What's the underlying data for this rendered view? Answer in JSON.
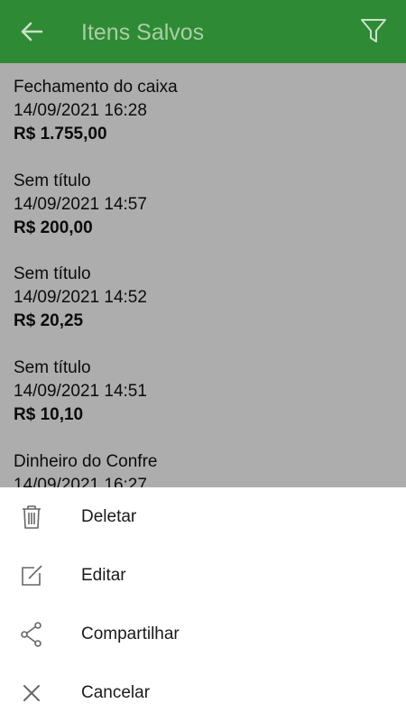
{
  "header": {
    "title": "Itens Salvos",
    "background": "#2f8a35",
    "back_icon": "arrow-left-icon",
    "filter_icon": "filter-icon"
  },
  "items": [
    {
      "name": "Fechamento do caixa",
      "date": "14/09/2021 16:28",
      "amount": "R$ 1.755,00"
    },
    {
      "name": "Sem título",
      "date": "14/09/2021 14:57",
      "amount": "R$ 200,00"
    },
    {
      "name": "Sem título",
      "date": "14/09/2021 14:52",
      "amount": "R$ 20,25"
    },
    {
      "name": "Sem título",
      "date": "14/09/2021 14:51",
      "amount": "R$ 10,10"
    },
    {
      "name": "Dinheiro do Confre",
      "date": "14/09/2021 16:27",
      "amount": ""
    }
  ],
  "sheet": {
    "actions": [
      {
        "label": "Deletar",
        "icon": "trash-icon"
      },
      {
        "label": "Editar",
        "icon": "edit-icon"
      },
      {
        "label": "Compartilhar",
        "icon": "share-icon"
      },
      {
        "label": "Cancelar",
        "icon": "close-icon"
      }
    ]
  }
}
